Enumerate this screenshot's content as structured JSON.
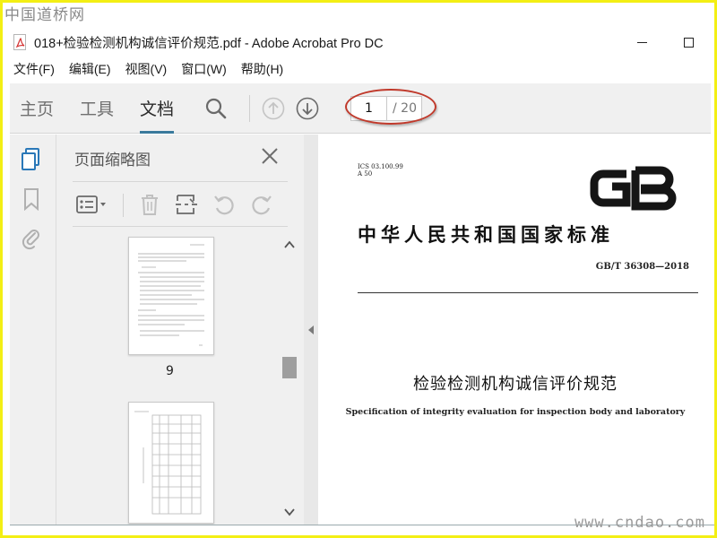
{
  "watermark": {
    "site_cn": "中国道桥网",
    "site_url": "www.cndao.com"
  },
  "window": {
    "title": "018+检验检测机构诚信评价规范.pdf - Adobe Acrobat Pro DC",
    "minimize_icon": "minimize-icon",
    "maximize_icon": "maximize-icon"
  },
  "menu": {
    "items": [
      "文件(F)",
      "编辑(E)",
      "视图(V)",
      "窗口(W)",
      "帮助(H)"
    ]
  },
  "toolbar": {
    "tabs": [
      "主页",
      "工具",
      "文档"
    ],
    "active_tab": "文档",
    "page_current": "1",
    "page_total": "/ 20"
  },
  "panel": {
    "title": "页面缩略图",
    "thumbnails": [
      {
        "label": "9"
      }
    ]
  },
  "document": {
    "ics": "ICS 03.100.99",
    "classification": "A 50",
    "logo": "GB",
    "standard_header": "中华人民共和国国家标准",
    "standard_number": "GB/T 36308—2018",
    "title_cn": "检验检测机构诚信评价规范",
    "title_en": "Specification of integrity evaluation for inspection body and laboratory"
  },
  "colors": {
    "frame": "#f3ef14",
    "accent": "#3a7a9c",
    "annotation": "#c0392b"
  }
}
